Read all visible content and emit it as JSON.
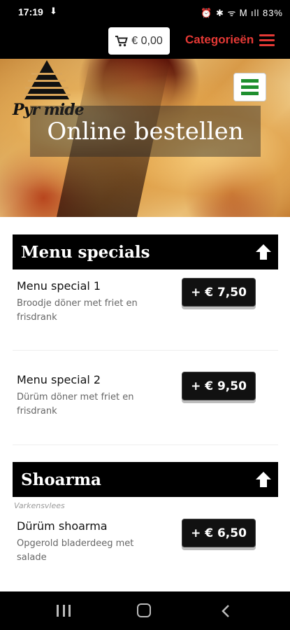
{
  "status_bar": {
    "time": "17:19",
    "download_icon": "download-arrow-icon",
    "icons_text": "⏰ ✱ ᯤ Ꮇ ıll 83%",
    "battery": "battery-icon"
  },
  "header": {
    "cart_total": "€ 0,00",
    "categories_label": "Categorieën",
    "accent_color": "#e53935"
  },
  "hero": {
    "logo_text": "Pyr mide",
    "title": "Online bestellen",
    "menu_toggle_color": "#1e8f2e"
  },
  "sections": [
    {
      "title": "Menu specials",
      "items": [
        {
          "name": "Menu special 1",
          "description": "Broodje döner met friet en frisdrank",
          "price": "+ € 7,50"
        },
        {
          "name": "Menu special 2",
          "description": "Dürüm döner met friet en frisdrank",
          "price": "+ € 9,50"
        }
      ]
    },
    {
      "title": "Shoarma",
      "subcategory": "Varkensvlees",
      "items": [
        {
          "name": "Dürüm shoarma",
          "description": "Opgerold bladerdeeg met salade",
          "price": "+ € 6,50"
        }
      ]
    }
  ]
}
